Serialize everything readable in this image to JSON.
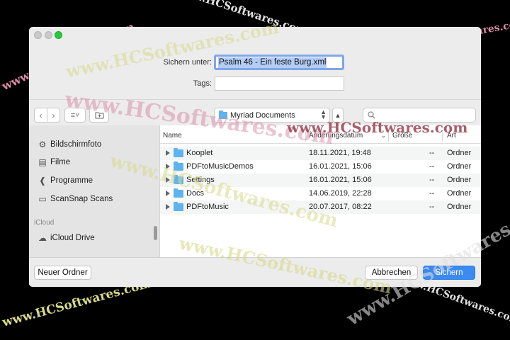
{
  "dialog": {
    "save_as_label": "Sichern unter:",
    "filename": "Psalm 46 -  Ein feste Burg.xml",
    "tags_label": "Tags:",
    "location": "Myriad Documents",
    "search_placeholder": ""
  },
  "sidebar": {
    "items": [
      {
        "label": "Bildschirmfoto",
        "icon": "screenshot-icon"
      },
      {
        "label": "Filme",
        "icon": "film-icon"
      },
      {
        "label": "Programme",
        "icon": "applications-icon"
      },
      {
        "label": "ScanSnap Scans",
        "icon": "folder-icon"
      }
    ],
    "section_icloud": "iCloud",
    "icloud_items": [
      {
        "label": "iCloud Drive",
        "icon": "cloud-icon"
      }
    ]
  },
  "filelist": {
    "columns": [
      "Name",
      "Änderungsdatum",
      "Größe",
      "Art"
    ],
    "rows": [
      {
        "name": "Kooplet",
        "date": "18.11.2021, 19:48",
        "size": "--",
        "kind": "Ordner"
      },
      {
        "name": "PDFtoMusicDemos",
        "date": "16.01.2021, 15:06",
        "size": "--",
        "kind": "Ordner"
      },
      {
        "name": "Settings",
        "date": "16.01.2021, 15:06",
        "size": "--",
        "kind": "Ordner"
      },
      {
        "name": "Docs",
        "date": "14.06.2019, 22:28",
        "size": "--",
        "kind": "Ordner"
      },
      {
        "name": "PDFtoMusic",
        "date": "20.07.2017, 08:22",
        "size": "--",
        "kind": "Ordner"
      }
    ]
  },
  "buttons": {
    "new_folder": "Neuer Ordner",
    "cancel": "Abbrechen",
    "save": "Sichern"
  },
  "watermark": {
    "text": "www.HCSoftwares.com",
    "color_pink": "#d98aa4",
    "color_yellow": "#d8d98a",
    "color_white": "#e8e8e8"
  },
  "colors": {
    "accent": "#3a8af0",
    "folder": "#5fb3ee",
    "selection": "#b3cdf6"
  }
}
